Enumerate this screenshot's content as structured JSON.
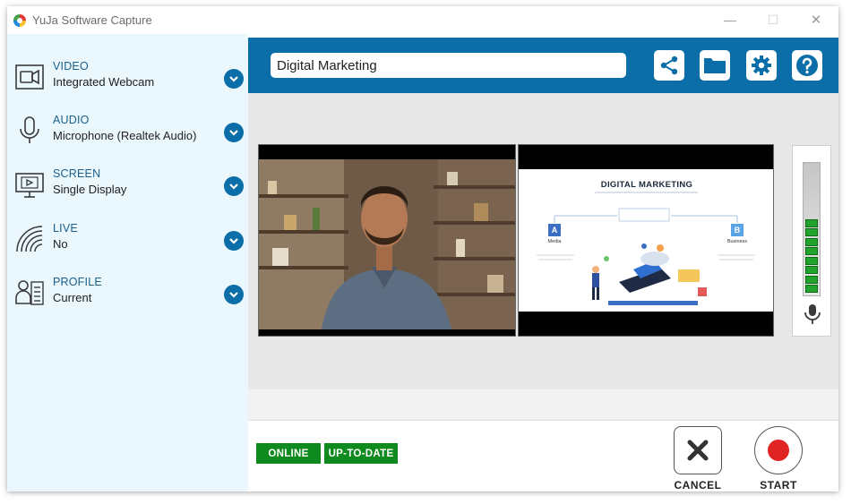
{
  "window": {
    "title": "YuJa Software Capture",
    "controls": {
      "minimize": "—",
      "maximize": "☐",
      "close": "✕"
    }
  },
  "sidebar": {
    "items": [
      {
        "title": "VIDEO",
        "value": "Integrated Webcam",
        "icon": "webcam-icon"
      },
      {
        "title": "AUDIO",
        "value": "Microphone (Realtek Audio)",
        "icon": "microphone-icon"
      },
      {
        "title": "SCREEN",
        "value": "Single Display",
        "icon": "display-icon"
      },
      {
        "title": "LIVE",
        "value": "No",
        "icon": "live-broadcast-icon"
      },
      {
        "title": "PROFILE",
        "value": "Current",
        "icon": "profile-icon"
      }
    ]
  },
  "header": {
    "session_title": "Digital Marketing",
    "tools": [
      "share-icon",
      "folder-icon",
      "gear-icon",
      "help-icon"
    ]
  },
  "preview": {
    "slide": {
      "title": "DIGITAL MARKETING",
      "label_a": "A",
      "label_b": "B",
      "caption_a": "Media",
      "caption_b": "Business"
    },
    "audio_level_segments": 8
  },
  "status": {
    "online": "ONLINE",
    "updated": "UP-TO-DATE"
  },
  "actions": {
    "cancel": "CANCEL",
    "start": "START"
  },
  "colors": {
    "brand_blue": "#0b6ea8",
    "sidebar_bg": "#eaf7fd",
    "status_green": "#0e8a1e",
    "record_red": "#e02424"
  }
}
